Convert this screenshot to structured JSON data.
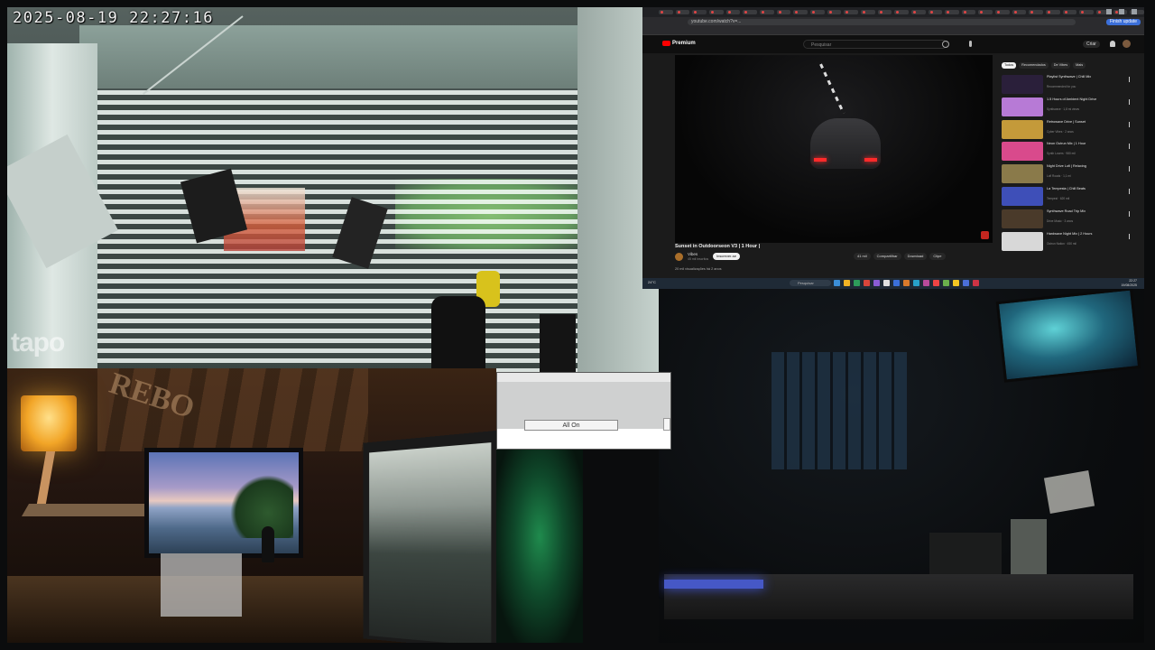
{
  "camera_feed": {
    "timestamp": "2025-08-19  22:27:16",
    "watermark": "tapo"
  },
  "screen_share": {
    "browser": {
      "address_url": "youtube.com/watch?v=...",
      "extension_button": "Finish update",
      "tab_count": 29
    },
    "youtube": {
      "logo_text": "Premium",
      "search_placeholder": "Pesquisar",
      "create_label": "Criar",
      "player": {
        "video_title": "Sunset in Outdoorseon V3 | 1 Hour |",
        "channel_name": "Vibes",
        "channel_subs": "45 mil inscritos",
        "subscribe_label": "Inscrever-se",
        "actions": [
          "41 mil",
          "Compartilhar",
          "Download",
          "Clipe"
        ],
        "description": "20 mil visualizações  há 2 anos"
      },
      "chips": [
        "Todos",
        "Recomendados",
        "De Vibes",
        "Mais"
      ],
      "recommendations": [
        {
          "title": "Playlist Synthwave | Chill Mix",
          "meta": "Recommended for you",
          "color": "#2a1f3a"
        },
        {
          "title": "1.5 Hours of Ambient Night Drive",
          "meta": "Synthwave · 1,8 mi views",
          "color": "#b77ad6"
        },
        {
          "title": "Retrowave Drive | Sunset",
          "meta": "Cyber Vibes · 2 anos",
          "color": "#c49a3a"
        },
        {
          "title": "Neon Outrun Mix | 1 Hour",
          "meta": "Synth Lovers · 980 mil",
          "color": "#d94a8c"
        },
        {
          "title": "Night Drive Lofi | Relaxing",
          "meta": "Lofi Roads · 1,1 mi",
          "color": "#8a7a4a"
        },
        {
          "title": "La Tempesta | Chill Beats",
          "meta": "Tempest · 620 mil",
          "color": "#3e4fb8"
        },
        {
          "title": "Synthwave Road Trip Mix",
          "meta": "Drive Music · 3 anos",
          "color": "#4a3a2a"
        },
        {
          "title": "Hardwave Night Mix | 2 Hours",
          "meta": "Outrun Nation · 450 mil",
          "color": "#d8d8d8"
        }
      ]
    },
    "taskbar": {
      "weather": "24°C",
      "search_label": "Pesquisar",
      "time": "22:27",
      "date": "19/08/2025"
    }
  },
  "control_panel": {
    "button_label": "All On"
  },
  "desk_feed": {
    "wall_text": "REBO"
  }
}
